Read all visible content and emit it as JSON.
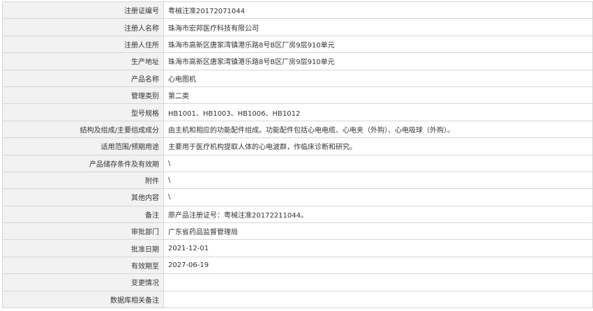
{
  "rows": [
    {
      "label": "注册证编号",
      "value": "粤械注准20172071044"
    },
    {
      "label": "注册人名称",
      "value": "珠海市宏邦医疗科技有限公司"
    },
    {
      "label": "注册人住所",
      "value": "珠海市高新区唐家湾镇港乐路8号B区厂房9层910单元"
    },
    {
      "label": "生产地址",
      "value": "珠海市高新区唐家湾镇港乐路8号B区厂房9层910单元"
    },
    {
      "label": "产品名称",
      "value": "心电图机"
    },
    {
      "label": "管理类别",
      "value": "第二类"
    },
    {
      "label": "型号规格",
      "value": "HB1001、HB1003、HB1006、HB1012"
    },
    {
      "label": "结构及组成/主要组成成分",
      "value": "由主机和相应的功能配件组成。功能配件包括心电电缆、心电夹（外购）、心电吸球（外购）。"
    },
    {
      "label": "适用范围/预期用途",
      "value": "主要用于医疗机构提取人体的心电波群，作临床诊断和研究。"
    },
    {
      "label": "产品储存条件及有效期",
      "value": "\\"
    },
    {
      "label": "附件",
      "value": "\\"
    },
    {
      "label": "其他内容",
      "value": "\\"
    },
    {
      "label": "备注",
      "value": "原产品注册证号：粤械注准20172211044。"
    },
    {
      "label": "审批部门",
      "value": "广东省药品监督管理局"
    },
    {
      "label": "批准日期",
      "value": "2021-12-01"
    },
    {
      "label": "有效期至",
      "value": "2027-06-19"
    },
    {
      "label": "变更情况",
      "value": ""
    },
    {
      "label": "数据库相关备注",
      "value": ""
    }
  ]
}
